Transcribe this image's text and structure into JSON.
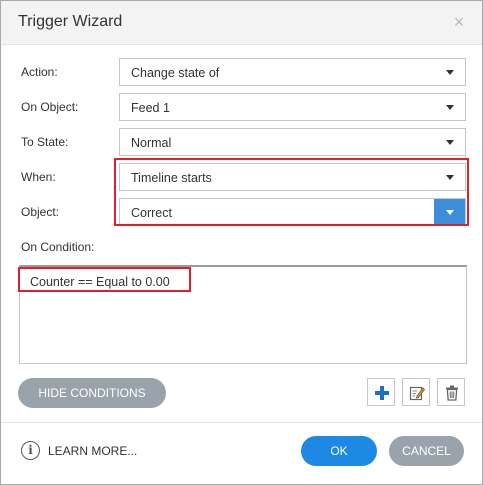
{
  "dialog": {
    "title": "Trigger Wizard",
    "close_glyph": "×"
  },
  "fields": {
    "action": {
      "label": "Action:",
      "value": "Change state of"
    },
    "on_object": {
      "label": "On Object:",
      "value": "Feed 1"
    },
    "to_state": {
      "label": "To State:",
      "value": "Normal"
    },
    "when": {
      "label": "When:",
      "value": "Timeline starts"
    },
    "object": {
      "label": "Object:",
      "value": "Correct"
    }
  },
  "conditions": {
    "label": "On Condition:",
    "items": [
      "Counter == Equal to 0.00"
    ]
  },
  "buttons": {
    "hide_conditions": "HIDE CONDITIONS",
    "ok": "OK",
    "cancel": "CANCEL"
  },
  "footer": {
    "learn_more": "LEARN MORE..."
  },
  "icons": [
    "close-icon",
    "chevron-down-icon",
    "plus-icon",
    "edit-icon",
    "trash-icon",
    "info-icon"
  ],
  "colors": {
    "accent": "#1e88e5",
    "select_accent": "#3c8dda",
    "gray_button": "#9aa3ab",
    "highlight": "#e0202b"
  }
}
